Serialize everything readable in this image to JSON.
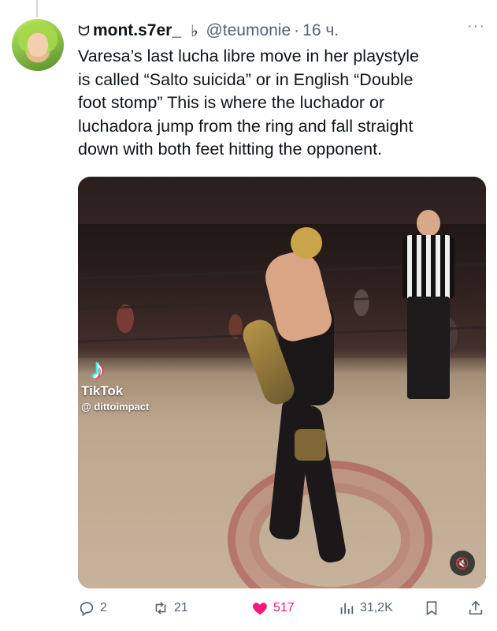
{
  "tweet": {
    "display_name": "mont.s7er_",
    "name_emoji": "ᗢ",
    "flair_icon": "♭",
    "handle": "@teumonie",
    "separator": "·",
    "time": "16 ч.",
    "more": "···",
    "text": "Varesa’s last lucha libre move in her playstyle\nis called “Salto suicida” or in English “Double\nfoot stomp” This is where the luchador or\nluchadora jump from the ring and fall straight\ndown with both feet hitting the opponent."
  },
  "media": {
    "watermark_app": "TikTok",
    "watermark_user": "@ dittoimpact",
    "mute_icon": "🔇"
  },
  "actions": {
    "replies": "2",
    "retweets": "21",
    "likes": "517",
    "views": "31,2K"
  },
  "colors": {
    "like": "#f91880",
    "muted_text": "#536471",
    "text": "#0f1419"
  }
}
